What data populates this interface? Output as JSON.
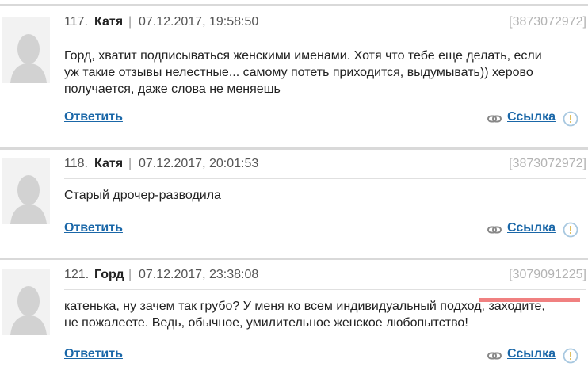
{
  "comments": [
    {
      "number": "117.",
      "author": "Катя",
      "separator": "|",
      "date": "07.12.2017, 19:58:50",
      "id": "[3873072972]",
      "lines": [
        "Горд, хватит подписываться женскими именами. Хотя что тебе еще делать, если",
        "уж такие отзывы нелестные... самому потеть приходится, выдумывать)) херово",
        "получается, даже слова не меняешь"
      ],
      "reply_label": "Ответить",
      "link_label": "Ссылка"
    },
    {
      "number": "118.",
      "author": "Катя",
      "separator": "|",
      "date": "07.12.2017, 20:01:53",
      "id": "[3873072972]",
      "lines": [
        "Старый дрочер-разводила"
      ],
      "reply_label": "Ответить",
      "link_label": "Ссылка"
    },
    {
      "number": "121.",
      "author": "Горд",
      "separator": "|",
      "date": "07.12.2017, 23:38:08",
      "id": "[3079091225]",
      "lines": [
        "катенька, ну зачем так грубо? У меня ко всем индивидуальный подход, заходите,",
        "не пожалеете. Ведь, обычное, умилительное женское любопытство!"
      ],
      "reply_label": "Ответить",
      "link_label": "Ссылка"
    }
  ],
  "icons": {
    "avatar": "user-silhouette-icon",
    "link": "chain-link-icon",
    "report": "exclamation-circle-icon"
  },
  "colors": {
    "link": "#1a67a8",
    "id": "#b3b3b3",
    "highlight": "#f08080"
  }
}
